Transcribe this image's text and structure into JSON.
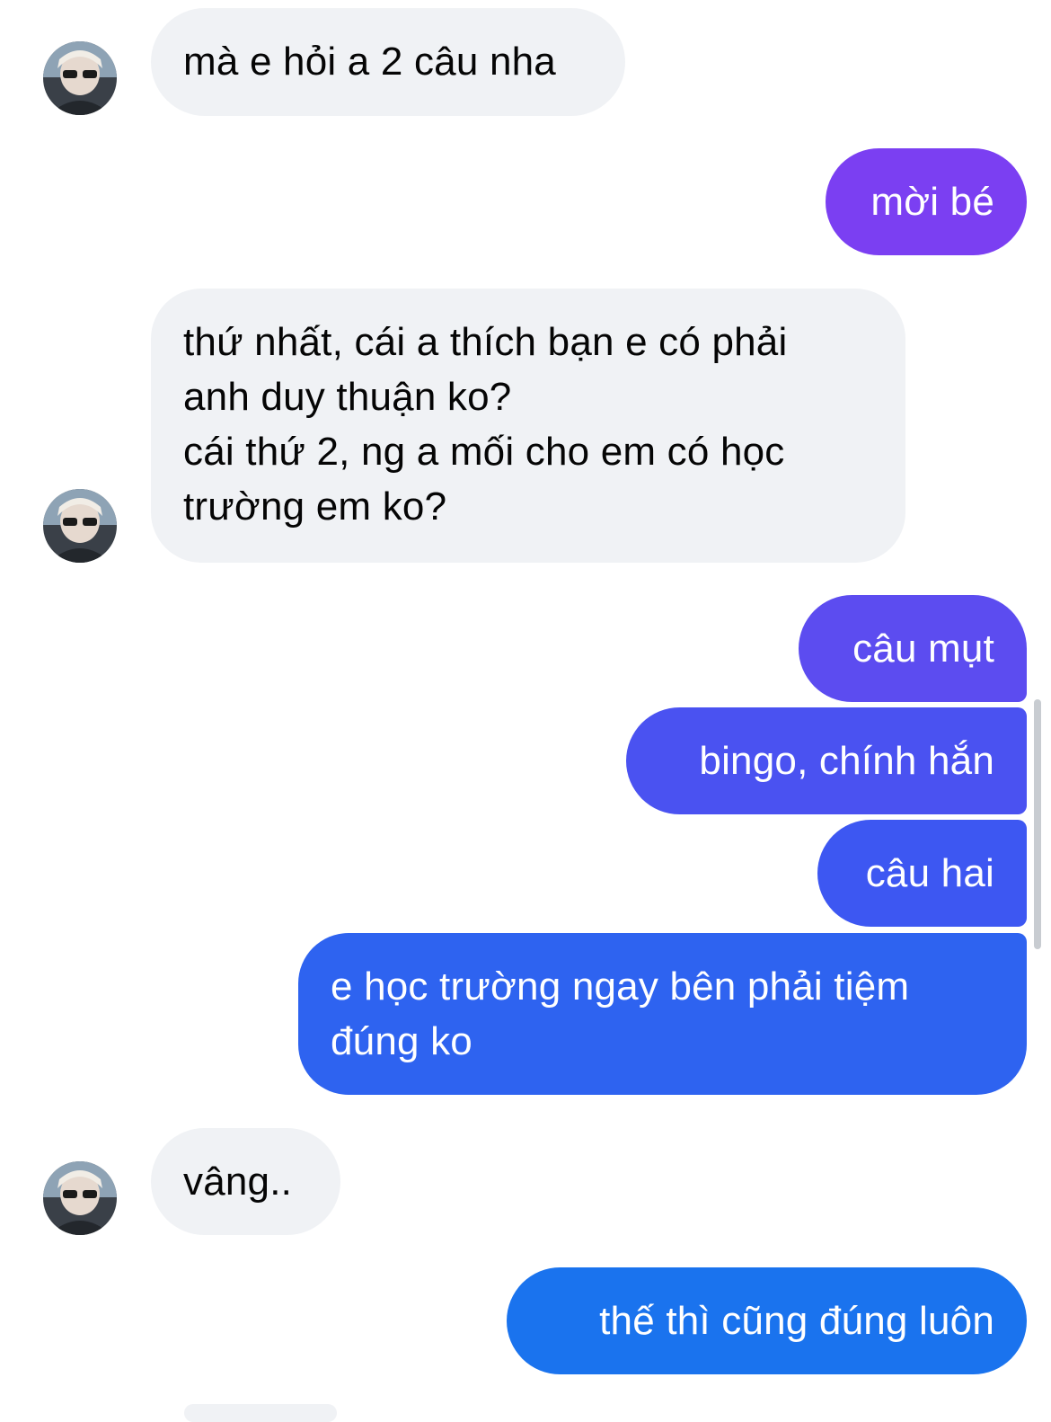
{
  "colors": {
    "received_bubble": "#f0f2f5",
    "received_text": "#050505",
    "sent_text": "#ffffff",
    "sent_gradient": [
      "#7b3ff2",
      "#5c4cf0",
      "#3d57f2",
      "#2e63f0",
      "#1a73ee"
    ]
  },
  "contact": {
    "avatar_icon": "user-avatar-photo"
  },
  "messages": [
    {
      "side": "received",
      "text": "mà e hỏi a 2 câu nha"
    },
    {
      "side": "sent",
      "text": "mời bé"
    },
    {
      "side": "received",
      "lines": [
        "thứ nhất, cái a thích bạn e có phải",
        "anh duy thuận ko?",
        "cái thứ 2, ng a mối cho em có học",
        "trường em ko?"
      ]
    },
    {
      "side": "sent",
      "text": "câu mụt"
    },
    {
      "side": "sent",
      "text": "bingo, chính hắn"
    },
    {
      "side": "sent",
      "text": "câu hai"
    },
    {
      "side": "sent",
      "lines": [
        "e học trường ngay bên phải tiệm",
        "đúng ko"
      ]
    },
    {
      "side": "received",
      "text": "vâng.."
    },
    {
      "side": "sent",
      "text": "thế thì cũng đúng luôn"
    }
  ]
}
